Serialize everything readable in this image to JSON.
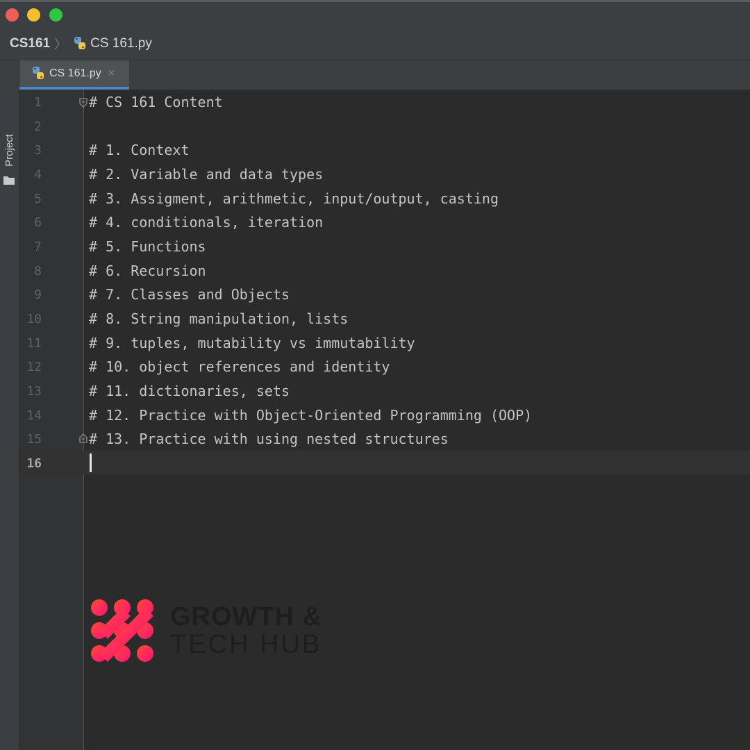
{
  "window": {
    "traffic_lights": [
      "close",
      "minimize",
      "zoom"
    ]
  },
  "breadcrumb": {
    "project": "CS161",
    "file": "CS 161.py"
  },
  "toolwindow": {
    "project_label": "Project"
  },
  "tabs": [
    {
      "label": "CS 161.py",
      "active": true,
      "close": "×"
    }
  ],
  "editor": {
    "current_line": 16,
    "lines": [
      {
        "number": "1",
        "text": "# CS 161 Content"
      },
      {
        "number": "2",
        "text": ""
      },
      {
        "number": "3",
        "text": "# 1. Context"
      },
      {
        "number": "4",
        "text": "# 2. Variable and data types"
      },
      {
        "number": "5",
        "text": "# 3. Assigment, arithmetic, input/output, casting"
      },
      {
        "number": "6",
        "text": "# 4. conditionals, iteration"
      },
      {
        "number": "7",
        "text": "# 5. Functions"
      },
      {
        "number": "8",
        "text": "# 6. Recursion"
      },
      {
        "number": "9",
        "text": "# 7. Classes and Objects"
      },
      {
        "number": "10",
        "text": "# 8. String manipulation, lists"
      },
      {
        "number": "11",
        "text": "# 9. tuples, mutability vs immutability"
      },
      {
        "number": "12",
        "text": "# 10. object references and identity"
      },
      {
        "number": "13",
        "text": "# 11. dictionaries, sets"
      },
      {
        "number": "14",
        "text": "# 12. Practice with Object-Oriented Programming (OOP)"
      },
      {
        "number": "15",
        "text": "# 13. Practice with using nested structures"
      },
      {
        "number": "16",
        "text": ""
      }
    ]
  },
  "watermark": {
    "line1": "GROWTH &",
    "line2": "TECH HUB"
  },
  "colors": {
    "background": "#2b2b2b",
    "gutter": "#313335",
    "chrome": "#3c3f41",
    "active_tab_underline": "#4a88c7",
    "comment_text": "#c4c4c4",
    "line_number": "#606366"
  }
}
